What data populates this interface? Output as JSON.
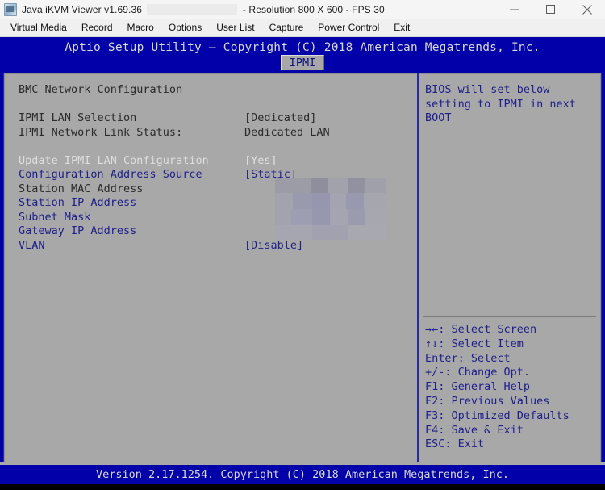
{
  "window": {
    "title_app": "Java iKVM Viewer v1.69.36",
    "title_redacted": "",
    "title_suffix": "- Resolution 800 X 600 - FPS 30",
    "icon": "kvm-app-icon",
    "controls": [
      {
        "name": "minimize",
        "glyph": "minimize-icon"
      },
      {
        "name": "maximize",
        "glyph": "maximize-icon"
      },
      {
        "name": "close",
        "glyph": "close-icon"
      }
    ]
  },
  "menubar": {
    "items": [
      {
        "label": "Virtual Media",
        "name": "menu-virtual-media"
      },
      {
        "label": "Record",
        "name": "menu-record"
      },
      {
        "label": "Macro",
        "name": "menu-macro"
      },
      {
        "label": "Options",
        "name": "menu-options"
      },
      {
        "label": "User List",
        "name": "menu-user-list"
      },
      {
        "label": "Capture",
        "name": "menu-capture"
      },
      {
        "label": "Power Control",
        "name": "menu-power-control"
      },
      {
        "label": "Exit",
        "name": "menu-exit"
      }
    ]
  },
  "bios": {
    "header_title": "Aptio Setup Utility – Copyright (C) 2018 American Megatrends, Inc.",
    "active_tab": "IPMI",
    "section_title": "BMC Network Configuration",
    "settings": [
      {
        "label": "IPMI LAN Selection",
        "value": "[Dedicated]",
        "style": "dark",
        "redacted": false
      },
      {
        "label": "IPMI Network Link Status:",
        "value": "Dedicated LAN",
        "style": "dark",
        "redacted": false
      },
      {
        "label": "Update IPMI LAN Configuration",
        "value": "[Yes]",
        "style": "white",
        "redacted": false
      },
      {
        "label": "Configuration Address Source",
        "value": "[Static]",
        "style": "blue",
        "redacted": false
      },
      {
        "label": "Station MAC Address",
        "value": "",
        "style": "dark",
        "redacted": true
      },
      {
        "label": "Station IP Address",
        "value": "",
        "style": "blue",
        "redacted": true
      },
      {
        "label": "Subnet Mask",
        "value": "",
        "style": "blue",
        "redacted": true
      },
      {
        "label": "Gateway IP Address",
        "value": "",
        "style": "blue",
        "redacted": true
      },
      {
        "label": "VLAN",
        "value": "[Disable]",
        "style": "blue",
        "redacted": false
      }
    ],
    "help_text": "BIOS will set below setting to IPMI in next BOOT",
    "legend": [
      "→←: Select Screen",
      "↑↓: Select Item",
      "Enter: Select",
      "+/-: Change Opt.",
      "F1: General Help",
      "F2: Previous Values",
      "F3: Optimized Defaults",
      "F4: Save & Exit",
      "ESC: Exit"
    ],
    "footer": "Version 2.17.1254. Copyright (C) 2018 American Megatrends, Inc."
  },
  "colors": {
    "bios_blue": "#0200a8",
    "panel_gray": "#a8a8a8",
    "text_blue": "#20208c",
    "text_dark": "#2b2b2b",
    "text_white": "#dedede"
  }
}
